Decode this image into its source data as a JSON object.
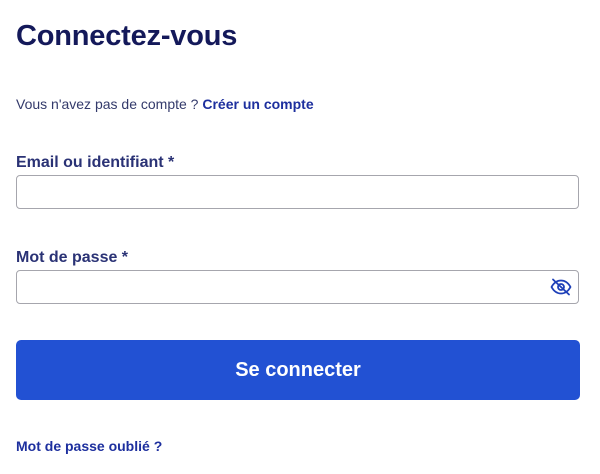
{
  "page": {
    "title": "Connectez-vous"
  },
  "signup": {
    "prompt": "Vous n'avez pas de compte ?",
    "link_label": "Créer un compte"
  },
  "form": {
    "email": {
      "label": "Email ou identifiant *",
      "value": "",
      "placeholder": ""
    },
    "password": {
      "label": "Mot de passe *",
      "value": "",
      "placeholder": "",
      "toggle_icon": "eye-slash-icon"
    },
    "submit_label": "Se connecter",
    "forgot_label": "Mot de passe oublié ?"
  },
  "colors": {
    "primary": "#2251d3",
    "heading": "#14195a",
    "link": "#1d2f9e",
    "input_border": "#a6a6ad"
  }
}
